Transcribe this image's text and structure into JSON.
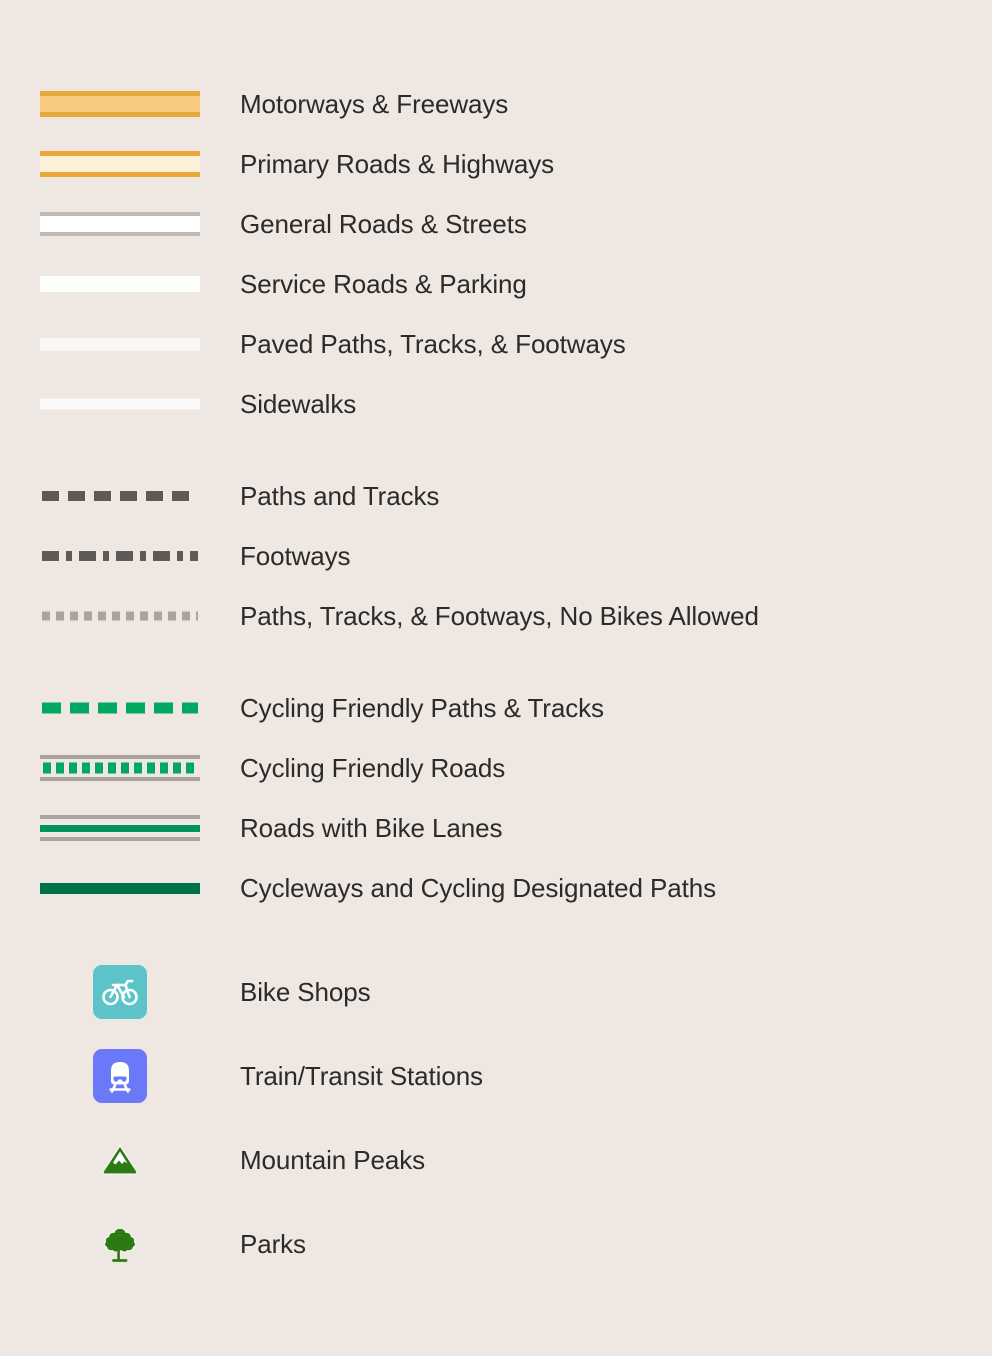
{
  "legend": {
    "background_color": "#efe7e1",
    "text_color": "#2b2b2b",
    "groups": [
      {
        "name": "road-hierarchy",
        "entries": [
          {
            "id": "motorways",
            "label": "Motorways & Freeways",
            "symbol": "casing-line",
            "fill": "#f6cb7f",
            "casing": "#e8a93a"
          },
          {
            "id": "primary-roads",
            "label": "Primary Roads & Highways",
            "symbol": "casing-line",
            "fill": "#fcf0d7",
            "casing": "#e8a93a"
          },
          {
            "id": "general-roads",
            "label": "General Roads & Streets",
            "symbol": "casing-line",
            "fill": "#ffffff",
            "casing": "#bdb8b4"
          },
          {
            "id": "service-roads",
            "label": "Service Roads & Parking",
            "symbol": "solid-line",
            "fill": "#fdfdfc",
            "casing": ""
          },
          {
            "id": "paved-paths",
            "label": "Paved Paths, Tracks, & Footways",
            "symbol": "solid-line",
            "fill": "#f8f7f6",
            "casing": ""
          },
          {
            "id": "sidewalks",
            "label": "Sidewalks",
            "symbol": "dashed-line",
            "fill": "#fbfaf9",
            "casing": ""
          }
        ]
      },
      {
        "name": "paths-and-tracks",
        "entries": [
          {
            "id": "paths-tracks",
            "label": "Paths and Tracks",
            "symbol": "dashed-line",
            "fill": "#5e5a57",
            "casing": ""
          },
          {
            "id": "footways",
            "label": "Footways",
            "symbol": "dash-dot-line",
            "fill": "#5e5a57",
            "casing": ""
          },
          {
            "id": "no-bikes-allowed",
            "label": "Paths, Tracks, & Footways, No Bikes Allowed",
            "symbol": "dotted-line",
            "fill": "#a8a3a0",
            "casing": ""
          }
        ]
      },
      {
        "name": "cycling-infrastructure",
        "entries": [
          {
            "id": "cycling-paths",
            "label": "Cycling Friendly Paths & Tracks",
            "symbol": "dashed-line",
            "fill": "#00a862",
            "casing": ""
          },
          {
            "id": "cycling-roads",
            "label": "Cycling Friendly Roads",
            "symbol": "dotted-casing",
            "fill": "#00a862",
            "casing": "#a8a39f"
          },
          {
            "id": "bike-lanes",
            "label": "Roads with Bike Lanes",
            "symbol": "center-line",
            "fill": "#00945e",
            "casing": "#a8a39f"
          },
          {
            "id": "cycleways",
            "label": "Cycleways and Cycling Designated Paths",
            "symbol": "solid-line",
            "fill": "#00724a",
            "casing": ""
          }
        ]
      },
      {
        "name": "points-of-interest",
        "entries": [
          {
            "id": "bike-shops",
            "label": "Bike Shops",
            "icon": "bicycle-icon",
            "tile_color": "#5cc4c8",
            "glyph_color": "#ffffff"
          },
          {
            "id": "transit-stations",
            "label": "Train/Transit Stations",
            "icon": "train-icon",
            "tile_color": "#6979f8",
            "glyph_color": "#ffffff"
          },
          {
            "id": "mountain-peaks",
            "label": "Mountain Peaks",
            "icon": "mountain-peak-icon",
            "tile_color": "",
            "glyph_color": "#2d7a14"
          },
          {
            "id": "parks",
            "label": "Parks",
            "icon": "tree-icon",
            "tile_color": "",
            "glyph_color": "#2d7a14"
          }
        ]
      }
    ]
  }
}
